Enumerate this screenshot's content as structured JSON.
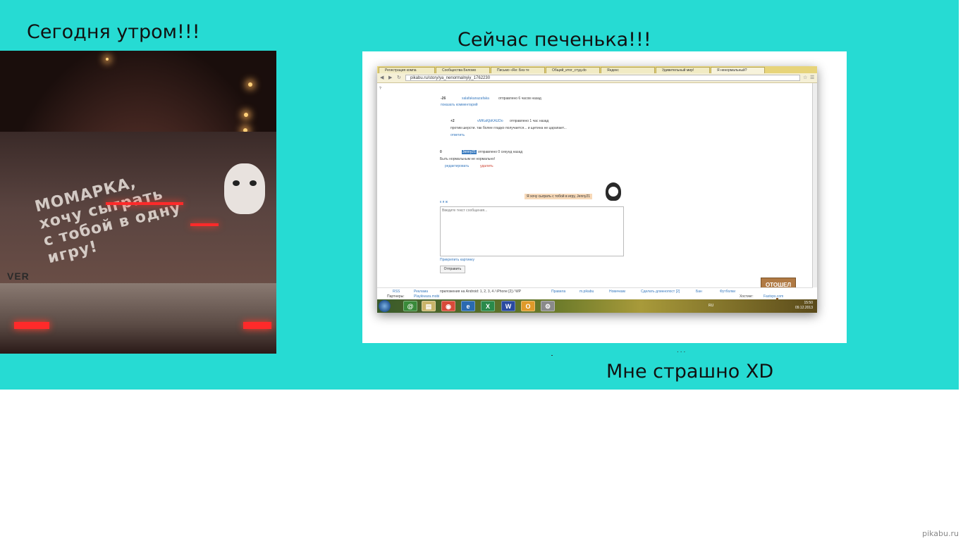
{
  "captions": {
    "left": "Сегодня утром!!!",
    "center": "Сейчас печенька!!!",
    "bottom": "Мне страшно XD",
    "dots": "..."
  },
  "photo": {
    "decal_line1": "МОМАРКА,",
    "decal_line2": "хочу сыграть",
    "decal_line3": "с тобой в одну игру!",
    "plate_text": "VER"
  },
  "browser": {
    "tabs": [
      "Регистрация компа",
      "Сообщества Беломо",
      "Письмо «Re: Без те",
      "Общий_итог_студ.do",
      "Яндекс",
      "Удивительный мир!",
      "Я ненормальный?"
    ],
    "url": "pikabu.ru/story/ya_nenormalnyiy_1762230",
    "page": {
      "marker": "?",
      "c1_score": "-26",
      "c1_user": "xalafakanazafaka",
      "c1_meta": "отправлено  6 часов назад",
      "c1_show": "показать комментарий",
      "c2_score": "+2",
      "c2_user": "vMKaKjbKAUDo",
      "c2_meta": "отправлено  1 час назад",
      "c2_text": "против шерсти. так более гладко получается... и щетина не царапает...",
      "c2_reply": "ответить",
      "c3_score": "0",
      "c3_user": "Jenny21",
      "c3_meta": "отправлено  0 секунд назад",
      "c3_text": "Быть нормальным не нормально!",
      "c3_edit": "редактировать",
      "c3_delete": "удалить",
      "bubble": "Я хочу сыграть с тобой в игру, Jenny21",
      "format_buttons": "к  я  ж",
      "placeholder": "Введите текст сообщения...",
      "attach": "Прикрепить картинку",
      "send": "Отправить",
      "sign": "ОТОШЕЛ"
    },
    "footer": {
      "rss": "RSS",
      "ads": "Реклама",
      "android": "приложения на Android: 1, 2, 3, 4 / iPhone [2] / WP",
      "rules": "Правила",
      "mobile": "m.pikabu",
      "newbie": "Новичкам",
      "longpost": "Сделать длиннопост [2]",
      "ban": "Бан",
      "shirts": "Футболки",
      "partners": "Партнеры:",
      "partner1": "Playkiwara.mobi",
      "hosting": "Хостинг:",
      "host": "Fastvps.com"
    },
    "taskbar": {
      "lang": "RU",
      "time": "15:50",
      "date": "09.12.2013"
    }
  },
  "watermark": "pikabu.ru"
}
